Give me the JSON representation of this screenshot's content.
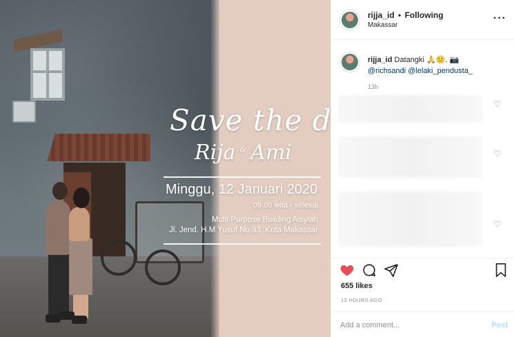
{
  "post_image": {
    "headline": "Save the date",
    "names": {
      "first": "Rija",
      "amp": "&",
      "second": "Ami"
    },
    "date": "Minggu, 12 Januari 2020",
    "time": "09.00 wita - selesai",
    "venue": "Multi Purpose Building Aisyiah",
    "address": "Jl. Jend. H.M Yusuf No.93. Kota Makassar"
  },
  "header": {
    "username": "rijja_id",
    "separator": "•",
    "follow_status": "Following",
    "location": "Makassar",
    "more": "···"
  },
  "caption": {
    "username": "rijja_id",
    "text": "Datangki 🙏🙂. 📷",
    "mentions": [
      "@richsandi",
      "@lelaki_pendusta_"
    ],
    "time": "13h"
  },
  "stats": {
    "likes": "655 likes",
    "posted_ago": "13 HOURS AGO"
  },
  "comment_box": {
    "placeholder": "Add a comment...",
    "post_label": "Post"
  },
  "colors": {
    "like_red": "#ed4956",
    "overlay_pink": "#e3cdc0",
    "post_disabled": "#b2dffc",
    "mention_blue": "#00376b"
  },
  "icons": [
    "heart-filled-icon",
    "comment-icon",
    "share-icon",
    "bookmark-icon",
    "heart-outline-icon",
    "more-icon"
  ]
}
